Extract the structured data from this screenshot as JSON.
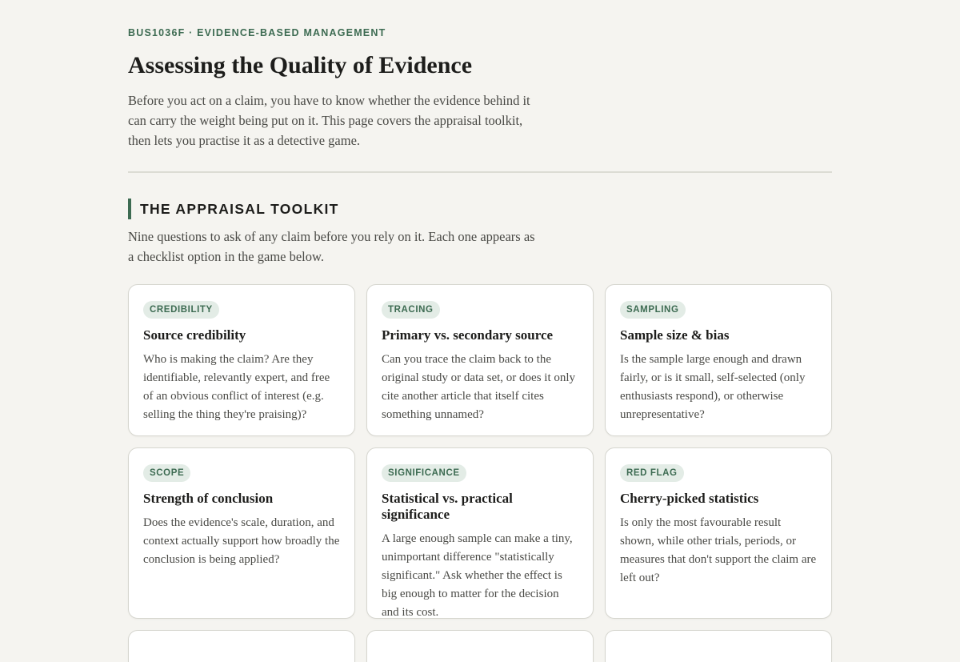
{
  "header": {
    "eyebrow": "BUS1036F · EVIDENCE-BASED MANAGEMENT",
    "title": "Assessing the Quality of Evidence",
    "intro": "Before you act on a claim, you have to know whether the evidence behind it can carry the weight being put on it. This page covers the appraisal toolkit, then lets you practise it as a detective game."
  },
  "toolkit": {
    "heading": "THE APPRAISAL TOOLKIT",
    "description": "Nine questions to ask of any claim before you rely on it. Each one appears as a checklist option in the game below.",
    "cards": [
      {
        "tag": "CREDIBILITY",
        "title": "Source credibility",
        "text": "Who is making the claim? Are they identifiable, relevantly expert, and free of an obvious conflict of interest (e.g. selling the thing they're praising)?"
      },
      {
        "tag": "TRACING",
        "title": "Primary vs. secondary source",
        "text": "Can you trace the claim back to the original study or data set, or does it only cite another article that itself cites something unnamed?"
      },
      {
        "tag": "SAMPLING",
        "title": "Sample size & bias",
        "text": "Is the sample large enough and drawn fairly, or is it small, self-selected (only enthusiasts respond), or otherwise unrepresentative?"
      },
      {
        "tag": "SCOPE",
        "title": "Strength of conclusion",
        "text": "Does the evidence's scale, duration, and context actually support how broadly the conclusion is being applied?"
      },
      {
        "tag": "SIGNIFICANCE",
        "title": "Statistical vs. practical significance",
        "text": "A large enough sample can make a tiny, unimportant difference \"statistically significant.\" Ask whether the effect is big enough to matter for the decision and its cost."
      },
      {
        "tag": "RED FLAG",
        "title": "Cherry-picked statistics",
        "text": "Is only the most favourable result shown, while other trials, periods, or measures that don't support the claim are left out?"
      }
    ]
  }
}
